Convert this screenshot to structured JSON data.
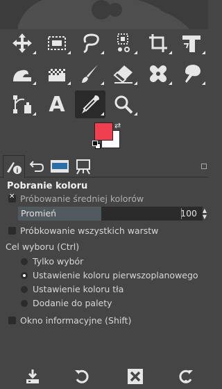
{
  "toolbox": {
    "tools": [
      {
        "icon": "move-icon"
      },
      {
        "icon": "rect-select-icon"
      },
      {
        "icon": "free-select-icon"
      },
      {
        "icon": "fuzzy-select-icon"
      },
      {
        "icon": "crop-icon"
      },
      {
        "icon": "unified-transform-icon"
      },
      {
        "icon": "warp-transform-icon"
      },
      {
        "icon": "gradient-icon"
      },
      {
        "icon": "paintbrush-icon"
      },
      {
        "icon": "eraser-icon"
      },
      {
        "icon": "heal-icon"
      },
      {
        "icon": "smudge-icon"
      },
      {
        "icon": "paths-icon"
      },
      {
        "icon": "text-tool-icon",
        "glyph": "A"
      },
      {
        "icon": "color-picker-icon"
      },
      {
        "icon": "zoom-icon"
      }
    ],
    "active_tool": "color-picker-icon",
    "foreground_color": "#f04050",
    "background_color": "#ffffff"
  },
  "tabs": [
    {
      "icon": "tool-options-icon"
    },
    {
      "icon": "undo-history-icon"
    },
    {
      "icon": "brushes-icon"
    },
    {
      "icon": "images-icon"
    }
  ],
  "options": {
    "title": "Pobranie koloru",
    "sample_average": {
      "label": "Próbowanie średniej kolorów",
      "checked": true
    },
    "radius": {
      "label": "Promień",
      "value": "100",
      "fraction": 0.45
    },
    "sample_merged": {
      "label": "Próbkowanie wszystkich warstw",
      "checked": false
    },
    "target_label": "Cel wyboru  (Ctrl)",
    "radios": [
      {
        "label": "Tylko wybór",
        "selected": false
      },
      {
        "label": "Ustawienie koloru pierwszoplanowego",
        "selected": true
      },
      {
        "label": "Ustawienie koloru tła",
        "selected": false
      },
      {
        "label": "Dodanie do palety",
        "selected": false
      }
    ],
    "info_window": {
      "label": "Okno informacyjne  (Shift)",
      "checked": false
    }
  },
  "bottom_buttons": [
    {
      "icon": "save-options-icon"
    },
    {
      "icon": "restore-options-icon"
    },
    {
      "icon": "delete-options-icon"
    },
    {
      "icon": "reset-options-icon"
    }
  ]
}
